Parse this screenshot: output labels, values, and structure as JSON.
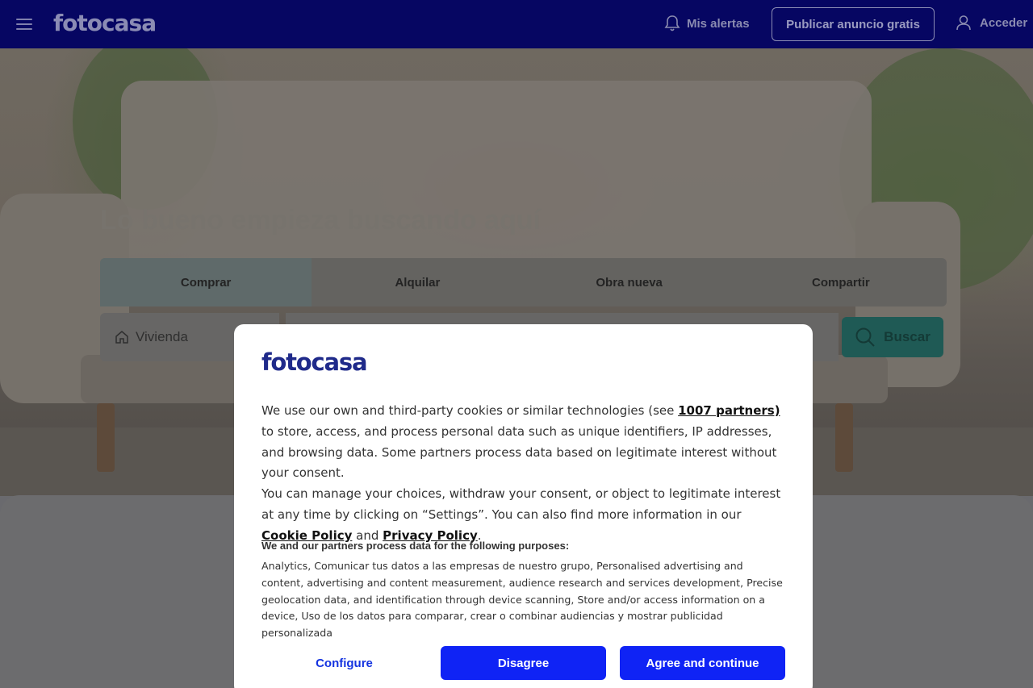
{
  "header": {
    "logo": "fotocasa",
    "alerts_label": "Mis alertas",
    "publish_label": "Publicar anuncio gratis",
    "login_label": "Acceder"
  },
  "hero": {
    "title": "Lo bueno empieza buscando aquí",
    "tabs": [
      {
        "label": "Comprar",
        "active": true
      },
      {
        "label": "Alquilar",
        "active": false
      },
      {
        "label": "Obra nueva",
        "active": false
      },
      {
        "label": "Compartir",
        "active": false
      }
    ],
    "property_type": "Vivienda",
    "search_label": "Buscar"
  },
  "cookie_modal": {
    "logo": "fotocasa",
    "p1_a": "We use our own and third-party cookies or similar technologies (see ",
    "partners_link": "1007 partners)",
    "p1_b": " to store, access, and process personal data such as unique identifiers, IP addresses, and browsing data. Some partners process data based on legitimate interest without your consent.",
    "p2_a": "You can manage your choices, withdraw your consent, or object to legitimate interest at any time by clicking on “Settings”. You can also find more information in our ",
    "cookie_policy_link": "Cookie Policy",
    "p2_and": " and ",
    "privacy_policy_link": "Privacy Policy",
    "p2_end": ".",
    "purposes_title": "We and our partners process data for the following purposes:",
    "purposes_text": "Analytics, Comunicar tus datos a las empresas de nuestro grupo, Personalised advertising and content, advertising and content measurement, audience research and services development, Precise geolocation data, and identification through device scanning, Store and/or access information on a device, Uso de los datos para comparar, crear o combinar audiencias y mostrar publicidad personalizada",
    "configure_label": "Configure",
    "disagree_label": "Disagree",
    "agree_label": "Agree and continue"
  },
  "colors": {
    "header_bg": "#060662",
    "modal_button": "#0f23f5",
    "brand_logo": "#1f2a8a"
  }
}
